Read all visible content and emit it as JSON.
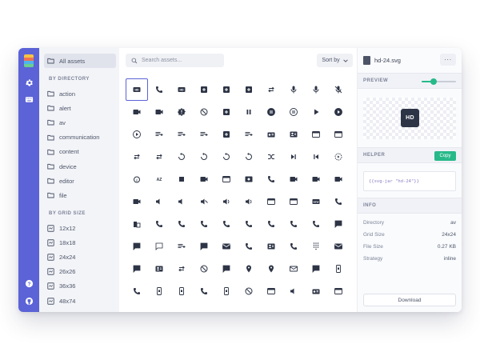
{
  "sidebar": {
    "all_label": "All assets",
    "by_directory_title": "BY DIRECTORY",
    "directories": [
      "action",
      "alert",
      "av",
      "communication",
      "content",
      "device",
      "editor",
      "file"
    ],
    "by_grid_title": "BY GRID SIZE",
    "grid_sizes": [
      "12x12",
      "18x18",
      "24x24",
      "26x26",
      "36x36",
      "48x74"
    ]
  },
  "toolbar": {
    "search_placeholder": "Search assets...",
    "sort_label": "Sort by"
  },
  "icons": [
    "hd-icon",
    "hearing-icon",
    "hd-alt-icon",
    "add-to-queue-icon",
    "library-books-icon",
    "library-music-icon",
    "loop-icon",
    "mic-icon",
    "mic-none-icon",
    "mic-off-icon",
    "movie-icon",
    "music-video-icon",
    "new-releases-icon",
    "not-interested-icon",
    "note-icon",
    "pause-icon",
    "pause-circle-filled-icon",
    "pause-circle-outline-icon",
    "play-arrow-icon",
    "play-circle-filled-icon",
    "play-circle-outline-icon",
    "playlist-add-icon",
    "playlist-add-check-icon",
    "queue-music-icon",
    "queue-icon",
    "playlist-play-icon",
    "radio-icon",
    "recent-actors-icon",
    "remove-from-queue-icon",
    "airplay-icon",
    "repeat-icon",
    "repeat-one-icon",
    "replay-10-icon",
    "replay-icon",
    "replay-30-icon",
    "replay-5-icon",
    "shuffle-icon",
    "skip-next-icon",
    "skip-previous-icon",
    "slow-motion-icon",
    "snooze-icon",
    "sort-by-alpha-icon",
    "stop-icon",
    "subscriptions-icon",
    "subtitles-icon",
    "surround-sound-icon",
    "video-call-icon",
    "video-label-icon",
    "video-library-icon",
    "videocam-icon",
    "videocam-off-icon",
    "volume-down-icon",
    "volume-mute-icon",
    "volume-off-icon",
    "volume-up-icon",
    "volume-up-alt-icon",
    "web-icon",
    "web-asset-icon",
    "fiber-new-icon",
    "dialer-sip-icon",
    "business-icon",
    "call-icon",
    "call-end-icon",
    "call-made-icon",
    "call-merge-icon",
    "call-missed-icon",
    "call-missed-outgoing-icon",
    "call-received-icon",
    "call-split-icon",
    "chat-icon",
    "chat-bubble-icon",
    "chat-bubble-outline-icon",
    "clear-all-icon",
    "comment-icon",
    "contact-mail-icon",
    "contact-phone-icon",
    "contacts-icon",
    "dialer-sip-alt-icon",
    "dialpad-icon",
    "email-icon",
    "forum-icon",
    "import-contacts-icon",
    "import-export-icon",
    "invert-colors-off-icon",
    "live-help-icon",
    "location-off-icon",
    "location-on-icon",
    "mail-outline-icon",
    "message-icon",
    "no-sim-icon",
    "phone-icon",
    "phonelink-erase-icon",
    "phonelink-lock-icon",
    "phonelink-ring-icon",
    "phonelink-setup-icon",
    "portable-wifi-off-icon",
    "present-to-all-icon",
    "ring-volume-icon",
    "rss-feed-icon",
    "screen-share-icon"
  ],
  "panel": {
    "file_name": "hd-24.svg",
    "more_label": "···",
    "preview_title": "PREVIEW",
    "preview_zoom": 0.35,
    "preview_glyph": "HD",
    "helper_title": "HELPER",
    "copy_label": "Copy",
    "code_snippet": "{{svg-jar \"hd-24\"}}",
    "info_title": "INFO",
    "info": [
      {
        "label": "Directory",
        "value": "av"
      },
      {
        "label": "Grid Size",
        "value": "24x24"
      },
      {
        "label": "File Size",
        "value": "0.27 KB"
      },
      {
        "label": "Strategy",
        "value": "inline"
      }
    ],
    "download_label": "Download"
  },
  "colors": {
    "accent": "#5b63d6",
    "success": "#27b989",
    "icon": "#2d3446",
    "logo_stripes": [
      "#f6c343",
      "#ee7350",
      "#4fb3ec",
      "#6bcf8f"
    ]
  }
}
